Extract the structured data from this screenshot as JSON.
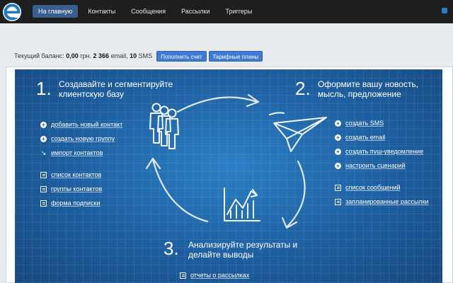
{
  "nav": {
    "items": [
      {
        "label": "На главную",
        "active": true
      },
      {
        "label": "Контакты",
        "active": false
      },
      {
        "label": "Сообщения",
        "active": false
      },
      {
        "label": "Рассылки",
        "active": false
      },
      {
        "label": "Триггеры",
        "active": false
      }
    ]
  },
  "balance": {
    "prefix": "Текущий баланс:",
    "amount": "0,00",
    "currency": "грн.",
    "email_count": "2 366",
    "email_label": "email,",
    "sms_count": "10",
    "sms_label": "SMS",
    "topup_label": "Пополнить счет",
    "plans_label": "Тарифные планы"
  },
  "steps": {
    "s1": {
      "number": "1.",
      "title_line1": "Создавайте и сегментируйте",
      "title_line2": "клиентскую базу",
      "actions": [
        "добавить новый контакт",
        "создать новую группу",
        "импорт контактов"
      ],
      "lists": [
        "список контактов",
        "группы контактов",
        "форма подписки"
      ]
    },
    "s2": {
      "number": "2.",
      "title_line1": "Оформите вашу новость,",
      "title_line2": "мысль, предложение",
      "actions": [
        "создать SMS",
        "создать email",
        "создать пуш-уведомление",
        "настроить сценарий"
      ],
      "lists": [
        "список сообщений",
        "запланированные рассылки"
      ]
    },
    "s3": {
      "number": "3.",
      "title_line1": "Анализируйте результаты и",
      "title_line2": "делайте выводы",
      "lists": [
        "отчеты о рассылках"
      ]
    }
  },
  "colors": {
    "topbar": "#1e1e1e",
    "nav_active": "#3b5f8c",
    "button": "#3f7bd2",
    "blueprint": "#1f64a8",
    "logo_accent": "#1f7ac4"
  },
  "icons": {
    "logo": "e-logo-icon",
    "action": "plus-circle-icon",
    "import": "import-icon",
    "list": "list-icon",
    "people": "people-icon",
    "paper_plane": "paper-plane-icon",
    "chart": "chart-icon",
    "arrow": "cycle-arrow-icon"
  }
}
